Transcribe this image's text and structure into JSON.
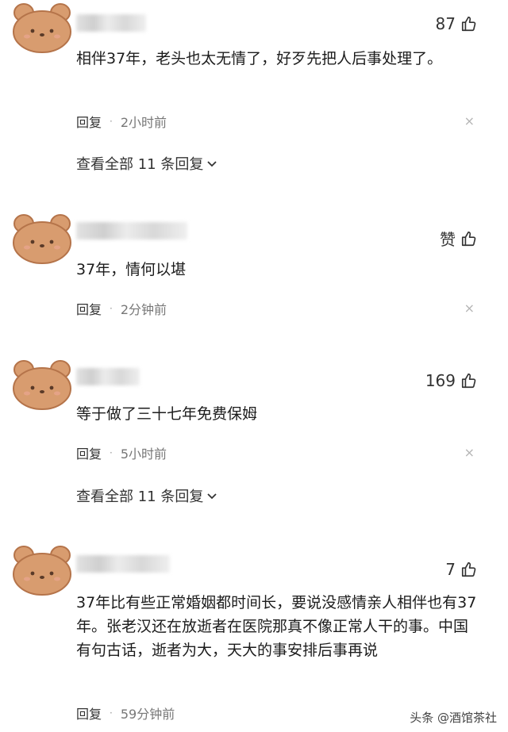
{
  "comments": [
    {
      "likes": "87",
      "text": "相伴37年，老头也太无情了，好歹先把人后事处理了。",
      "reply_label": "回复",
      "time": "2小时前",
      "view_all": "查看全部 11 条回复"
    },
    {
      "likes": "赞",
      "text": "37年，情何以堪",
      "reply_label": "回复",
      "time": "2分钟前"
    },
    {
      "likes": "169",
      "text": "等于做了三十七年免费保姆",
      "reply_label": "回复",
      "time": "5小时前",
      "view_all": "查看全部 11 条回复"
    },
    {
      "likes": "7",
      "text": "37年比有些正常婚姻都时间长，要说没感情亲人相伴也有37年。张老汉还在放逝者在医院那真不像正常人干的事。中国有句古话，逝者为大，天大的事安排后事再说",
      "reply_label": "回复",
      "time": "59分钟前"
    }
  ],
  "separator": "·",
  "close_glyph": "×",
  "watermark": "头条 @酒馆茶社",
  "colors": {
    "avatar_fill": "#d89c6f",
    "avatar_stroke": "#b5744a"
  }
}
